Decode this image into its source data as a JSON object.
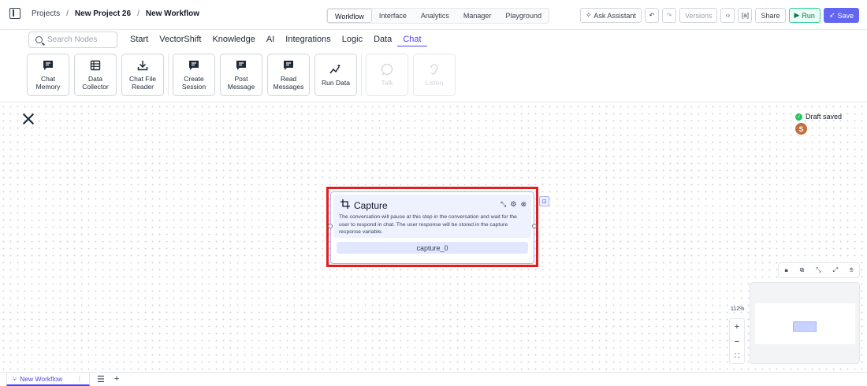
{
  "breadcrumb": {
    "projects": "Projects",
    "sep": "/",
    "project": "New Project 26",
    "workflow": "New Workflow"
  },
  "mode_tabs": [
    "Workflow",
    "Interface",
    "Analytics",
    "Manager",
    "Playground"
  ],
  "mode_active": "Workflow",
  "header_buttons": {
    "ask": "Ask Assistant",
    "undo": "↶",
    "redo": "↷",
    "versions": "Versions",
    "code": "‹›",
    "format": "[a]",
    "share": "Share",
    "run": "Run",
    "save": "Save"
  },
  "palette": {
    "search_placeholder": "Search Nodes",
    "categories": [
      "Start",
      "VectorShift",
      "Knowledge",
      "AI",
      "Integrations",
      "Logic",
      "Data",
      "Chat"
    ],
    "active_category": "Chat",
    "tiles": [
      {
        "label_1": "Chat",
        "label_2": "Memory",
        "icon": "chat-bubble-icon"
      },
      {
        "label_1": "Data",
        "label_2": "Collector",
        "icon": "table-icon"
      },
      {
        "label_1": "Chat File",
        "label_2": "Reader",
        "icon": "download-icon"
      },
      {
        "label_1": "Create",
        "label_2": "Session",
        "icon": "chat-bubble-icon"
      },
      {
        "label_1": "Post",
        "label_2": "Message",
        "icon": "chat-bubble-icon"
      },
      {
        "label_1": "Read",
        "label_2": "Messages",
        "icon": "chat-bubble-icon"
      },
      {
        "label_1": "Run Data",
        "label_2": "",
        "icon": "sparkle-chart-icon"
      },
      {
        "label_1": "Talk",
        "label_2": "",
        "icon": "talk-icon"
      },
      {
        "label_1": "Listen",
        "label_2": "",
        "icon": "listen-icon"
      }
    ]
  },
  "canvas": {
    "draft_status": "Draft saved",
    "avatar_initial": "S",
    "zoom": "112%"
  },
  "node": {
    "title": "Capture",
    "description": "The conversation will pause at this step in the conversation and wait for the user to respond in chat. The user response will be stored in the capture response variable.",
    "output": "capture_0"
  },
  "bottom": {
    "workflow_tab": "New Workflow"
  },
  "colors": {
    "accent": "#4f46e5",
    "highlight": "#e11d1d",
    "run": "#047857",
    "save": "#6366f1"
  }
}
